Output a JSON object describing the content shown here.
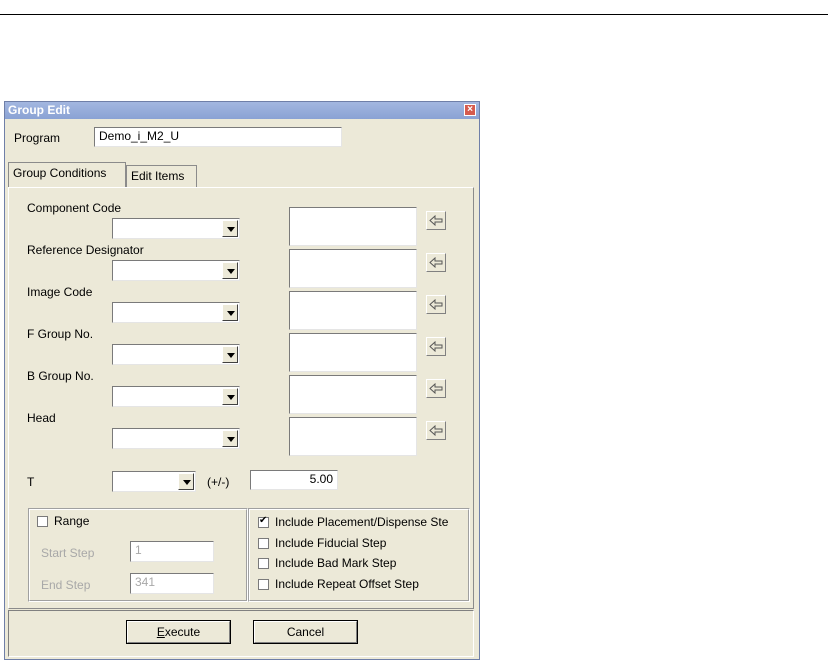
{
  "window": {
    "title": "Group Edit",
    "close_icon": "close-icon"
  },
  "program": {
    "label": "Program",
    "value": "Demo_i_M2_U"
  },
  "tabs": [
    {
      "label": "Group Conditions",
      "active": true
    },
    {
      "label": "Edit Items",
      "active": false
    }
  ],
  "fields": [
    {
      "label": "Component Code"
    },
    {
      "label": "Reference Designator"
    },
    {
      "label": "Image Code"
    },
    {
      "label": "F Group No."
    },
    {
      "label": "B Group No."
    },
    {
      "label": "Head"
    }
  ],
  "t": {
    "label": "T",
    "tolerance_label": "(+/-)",
    "tolerance_value": "5.00"
  },
  "range": {
    "label": "Range",
    "checked": false,
    "start_label": "Start Step",
    "start_value": "1",
    "end_label": "End Step",
    "end_value": "341"
  },
  "includes": [
    {
      "label": "Include Placement/Dispense Ste",
      "checked": true
    },
    {
      "label": "Include Fiducial Step",
      "checked": false
    },
    {
      "label": "Include Bad Mark Step",
      "checked": false
    },
    {
      "label": "Include Repeat Offset Step",
      "checked": false
    }
  ],
  "buttons": {
    "execute_rest": "xecute",
    "execute_mnemonic": "E",
    "cancel": "Cancel"
  }
}
